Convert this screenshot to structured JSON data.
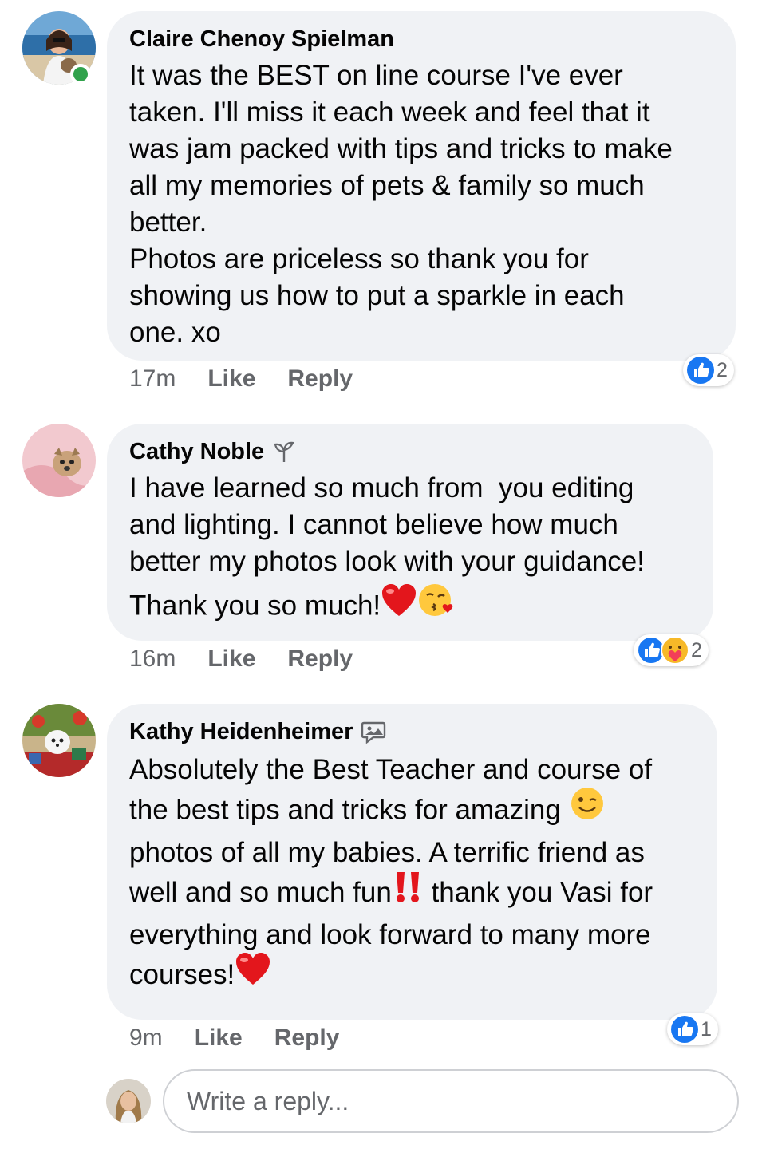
{
  "colors": {
    "bubble_bg": "#f0f2f5",
    "meta_text": "#65676b",
    "like_blue": "#1877f2",
    "online_green": "#31a24c"
  },
  "comments": [
    {
      "author": "Claire Chenoy Spielman",
      "badge_icon": "",
      "text_lines": [
        "It was the BEST on line course I've ever",
        "taken. I'll miss it each week and feel that it",
        "was jam packed with tips and tricks to make",
        "all my memories of pets & family so much",
        "better.",
        "Photos are priceless so thank you for",
        "showing us how to put a sparkle in each",
        "one. xo"
      ],
      "time": "17m",
      "like_label": "Like",
      "reply_label": "Reply",
      "reaction_icons": [
        "like-icon"
      ],
      "reaction_count": "2",
      "online": true
    },
    {
      "author": "Cathy Noble",
      "badge_icon": "rising-fan-sprout-icon",
      "text_lines": [
        "I have learned so much from  you editing",
        "and lighting. I cannot believe how much",
        "better my photos look with your guidance!",
        "Thank you so much!"
      ],
      "trailing_emojis": [
        "red-heart-emoji",
        "kissing-face-emoji"
      ],
      "time": "16m",
      "like_label": "Like",
      "reply_label": "Reply",
      "reaction_icons": [
        "like-icon",
        "care-icon"
      ],
      "reaction_count": "2",
      "online": false
    },
    {
      "author": "Kathy Heidenheimer",
      "badge_icon": "conversation-starter-icon",
      "text_parts": {
        "line1": "Absolutely the Best Teacher and course of",
        "line2": "the best tips and tricks for amazing ",
        "line3": "photos of all my babies. A terrific friend as",
        "line4a": "well and so much fun",
        "line4b": " thank you Vasi for",
        "line5": "everything and look forward to many more",
        "line6": "courses!"
      },
      "time": "9m",
      "like_label": "Like",
      "reply_label": "Reply",
      "reaction_icons": [
        "like-icon"
      ],
      "reaction_count": "1",
      "online": false
    }
  ],
  "reply_box": {
    "placeholder": "Write a reply..."
  }
}
